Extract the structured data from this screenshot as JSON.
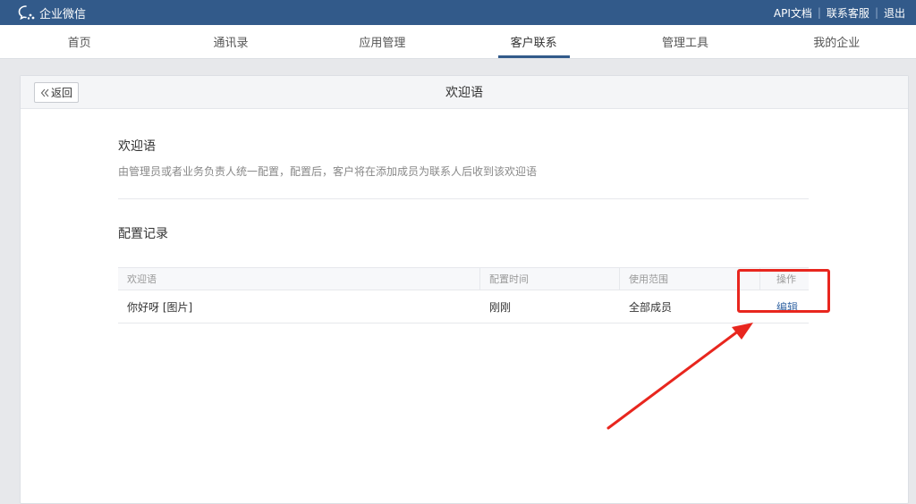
{
  "topbar": {
    "brand": "企业微信",
    "links": [
      "API文档",
      "联系客服",
      "退出"
    ],
    "bg_color": "#325a8a"
  },
  "nav": {
    "items": [
      "首页",
      "通讯录",
      "应用管理",
      "客户联系",
      "管理工具",
      "我的企业"
    ],
    "active_index": 3
  },
  "panel": {
    "back_label": "返回",
    "title": "欢迎语"
  },
  "welcome_section": {
    "title": "欢迎语",
    "description": "由管理员或者业务负责人统一配置，配置后，客户将在添加成员为联系人后收到该欢迎语"
  },
  "records_section": {
    "title": "配置记录",
    "columns": [
      "欢迎语",
      "配置时间",
      "使用范围",
      "操作"
    ],
    "rows": [
      {
        "message": "你好呀 [图片]",
        "time": "刚刚",
        "scope": "全部成员",
        "action": "编辑"
      }
    ]
  },
  "annotation": {
    "color": "#e8261e",
    "icon": "arrow-icon"
  }
}
